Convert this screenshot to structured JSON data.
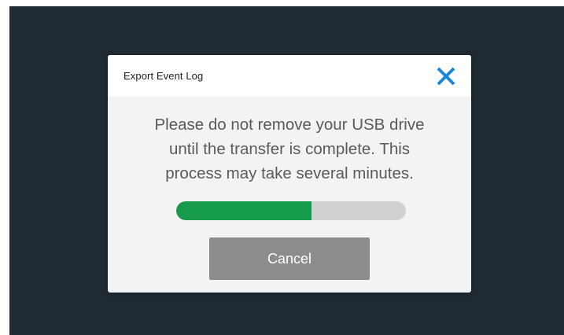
{
  "dialog": {
    "title": "Export Event Log",
    "close_icon": "close-x-icon",
    "message_lines": [
      "Please do not remove your USB drive",
      "until the transfer is complete. This",
      "process may take several minutes."
    ],
    "progress_fraction": 0.59,
    "cancel_label": "Cancel"
  },
  "colors": {
    "screen_background": "#1f2a33",
    "dialog_background": "#f2f3f2",
    "header_background": "#ffffff",
    "close_icon": "#1b86d8",
    "progress_fill": "#169a4c",
    "progress_track": "#d0d0d0",
    "cancel_button": "#8c8c8c"
  }
}
